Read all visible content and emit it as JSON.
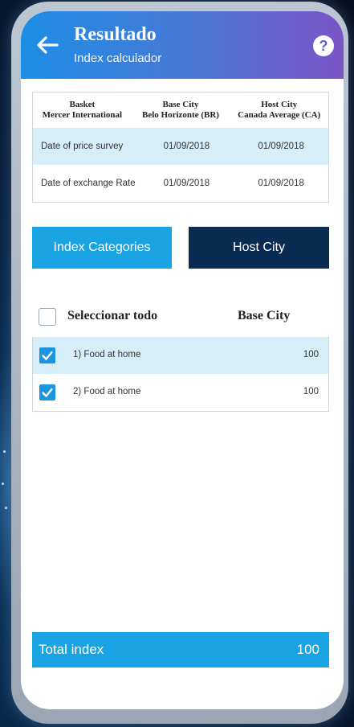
{
  "header": {
    "title": "Resultado",
    "subtitle": "Index calculador",
    "help_symbol": "?",
    "gradient_colors": [
      "#1c8ee6",
      "#7c54c6"
    ]
  },
  "info_table": {
    "columns": [
      {
        "line1": "Basket",
        "line2": "Mercer International"
      },
      {
        "line1": "Base City",
        "line2": "Belo Horizonte (BR)"
      },
      {
        "line1": "Host City",
        "line2": "Canada Average (CA)"
      }
    ],
    "rows": [
      {
        "label": "Date of price survey",
        "base": "01/09/2018",
        "host": "01/09/2018"
      },
      {
        "label": "Date of exchange Rate",
        "base": "01/09/2018",
        "host": "01/09/2018"
      }
    ]
  },
  "tabs": {
    "categories": "Index Categories",
    "host": "Host City"
  },
  "selection": {
    "select_all_label": "Seleccionar todo",
    "base_city_label": "Base City",
    "items": [
      {
        "label": "1) Food at home",
        "value": "100",
        "checked": true
      },
      {
        "label": "2) Food at home",
        "value": "100",
        "checked": true
      }
    ]
  },
  "total": {
    "label": "Total index",
    "value": "100"
  },
  "colors": {
    "accent": "#1aa3e3",
    "dark_tab": "#0b2c52",
    "row_shade": "#d6eef8",
    "checkbox": "#1c95e0"
  },
  "icons": {
    "back": "arrow-left-icon",
    "help": "question-circle-icon",
    "check": "checkmark-icon"
  }
}
